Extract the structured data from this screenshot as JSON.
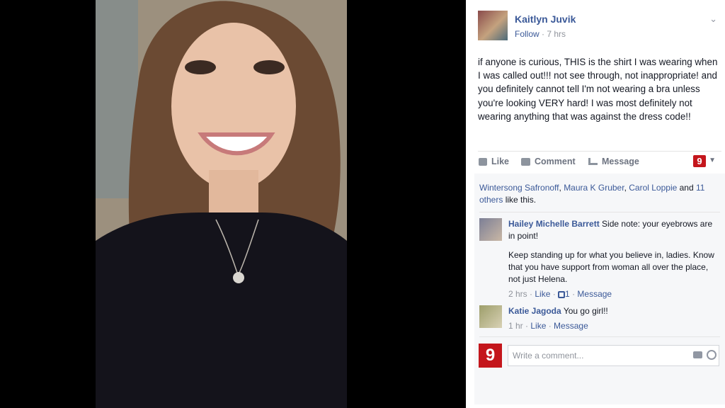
{
  "post": {
    "author": "Kaitlyn Juvik",
    "follow_label": "Follow",
    "separator": " · ",
    "time": "7 hrs",
    "text": "if anyone is curious, THIS is the shirt I was wearing when I was called out!!! not see through, not inappropriate! and you definitely cannot tell I'm not wearing a bra unless you're looking VERY hard! I was most definitely not wearing anything that was against the dress code!!"
  },
  "actions": {
    "like": "Like",
    "comment": "Comment",
    "message": "Message",
    "page_badge": "9"
  },
  "likes": {
    "name1": "Wintersong Safronoff",
    "sep1": ", ",
    "name2": "Maura K Gruber",
    "sep2": ", ",
    "name3": "Carol Loppie",
    "and": " and ",
    "others": "11 others",
    "suffix": " like this."
  },
  "comments": [
    {
      "author": "Hailey Michelle Barrett",
      "text1": " Side note: your eyebrows are in point!",
      "text2": "Keep standing up for what you believe in, ladies. Know that you have support from woman all over the place, not just Helena.",
      "time": "2 hrs",
      "sep": " · ",
      "like": "Like",
      "like_count": "1",
      "message": "Message"
    },
    {
      "author": "Katie Jagoda",
      "text1": " You go girl!!",
      "time": "1 hr",
      "sep": " · ",
      "like": "Like",
      "message": "Message"
    }
  ],
  "compose": {
    "logo": "9",
    "placeholder": "Write a comment..."
  },
  "colors": {
    "link": "#3b5998",
    "brand_red": "#c4161c",
    "muted": "#90949c"
  }
}
